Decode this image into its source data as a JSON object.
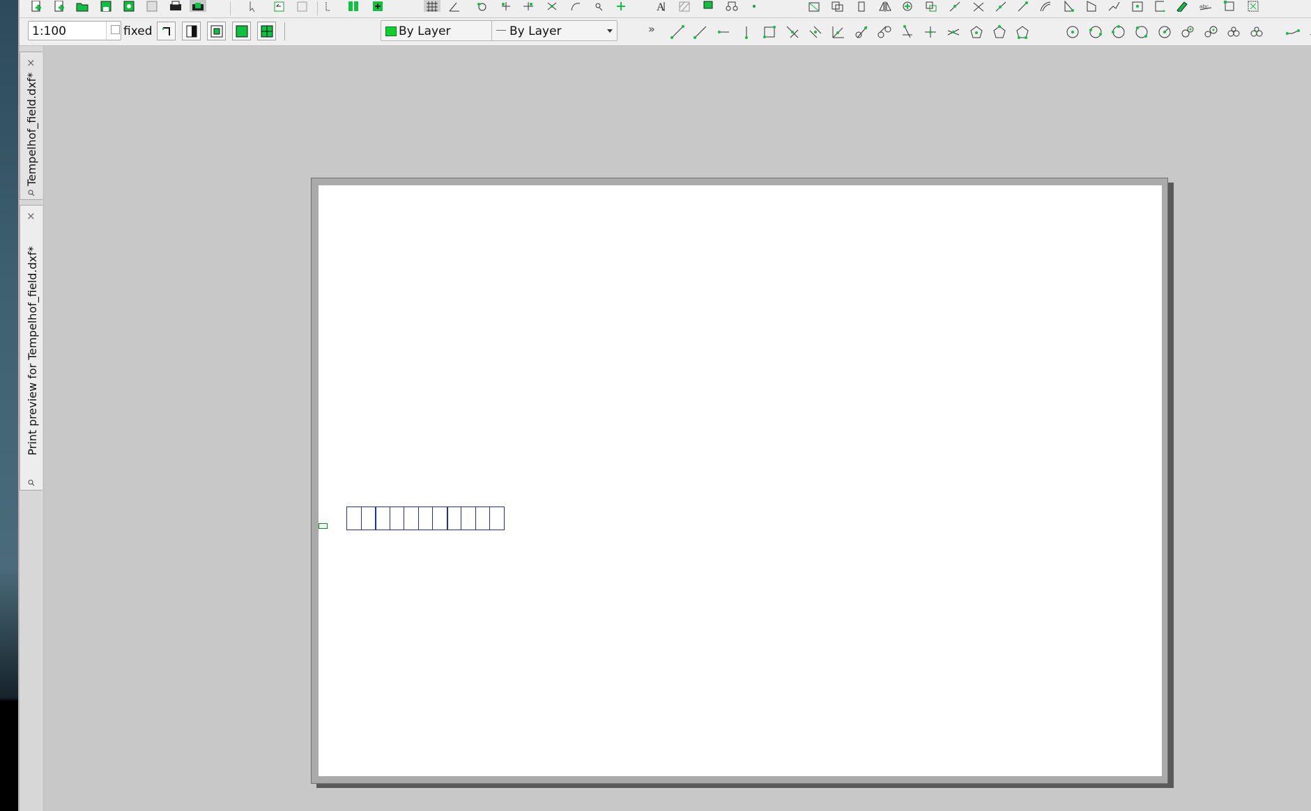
{
  "toolbar_top": {
    "icons": [
      "new-icon",
      "new-template-icon",
      "open-icon",
      "save-icon",
      "save-as-icon",
      "save-all-icon",
      "print-icon",
      "print-preview-icon",
      "select-icon",
      "undo-icon",
      "redo-icon",
      "snap-free-icon",
      "snap-grid-icon",
      "snap-endpoint-icon",
      "grid-icon",
      "snap-icon",
      "rotate-icon",
      "move-icon",
      "move-rotate-icon",
      "scale-icon",
      "mirror-icon",
      "zoom-icon",
      "pan-icon",
      "text-icon",
      "hatch-icon",
      "image-icon",
      "block-icon",
      "point-icon"
    ]
  },
  "print_toolbar": {
    "scale_value": "1:100",
    "fixed_label": "fixed",
    "fixed_checked": false,
    "color_combo": "By Layer",
    "color_swatch": "#10d030",
    "linetype_combo": "By Layer",
    "more_label": "»"
  },
  "tabs": [
    {
      "label": "Tempelhof_field.dxf*",
      "close": "×"
    },
    {
      "label": "Print preview for Tempelhof_field.dxf*",
      "close": "×"
    }
  ],
  "drawing": {
    "cell_count": 11,
    "stroke_color": "#1a2ad0"
  }
}
